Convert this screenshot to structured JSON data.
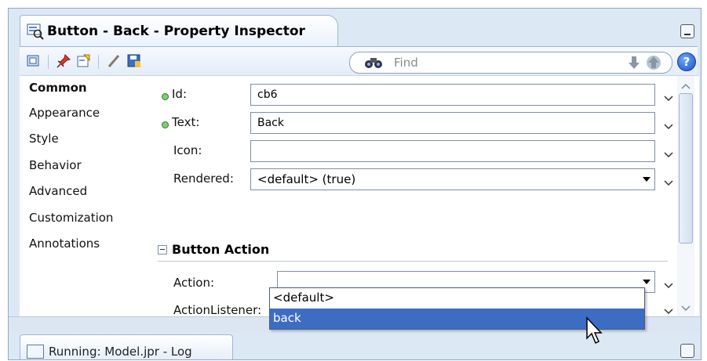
{
  "window": {
    "title": "Button - Back - Property Inspector"
  },
  "toolbar": {
    "find_placeholder": "Find",
    "help_label": "?"
  },
  "nav": {
    "items": [
      {
        "label": "Common",
        "active": true
      },
      {
        "label": "Appearance"
      },
      {
        "label": "Style"
      },
      {
        "label": "Behavior"
      },
      {
        "label": "Advanced"
      },
      {
        "label": "Customization"
      },
      {
        "label": "Annotations"
      }
    ]
  },
  "form": {
    "id_label": "Id:",
    "id_value": "cb6",
    "text_label": "Text:",
    "text_value": "Back",
    "icon_label": "Icon:",
    "icon_value": "",
    "rendered_label": "Rendered:",
    "rendered_value": "<default> (true)",
    "section_title": "Button Action",
    "action_label": "Action:",
    "action_value": "",
    "actionlistener_label": "ActionListener:"
  },
  "dropdown": {
    "options": [
      "<default>",
      "back"
    ],
    "selected": "back"
  },
  "bottom_tab": {
    "label": "Running: Model.jpr - Log"
  },
  "colors": {
    "frame_bg": "#dde8f5",
    "selection": "#3d6cc3",
    "required_dot": "#7fcf6f"
  }
}
